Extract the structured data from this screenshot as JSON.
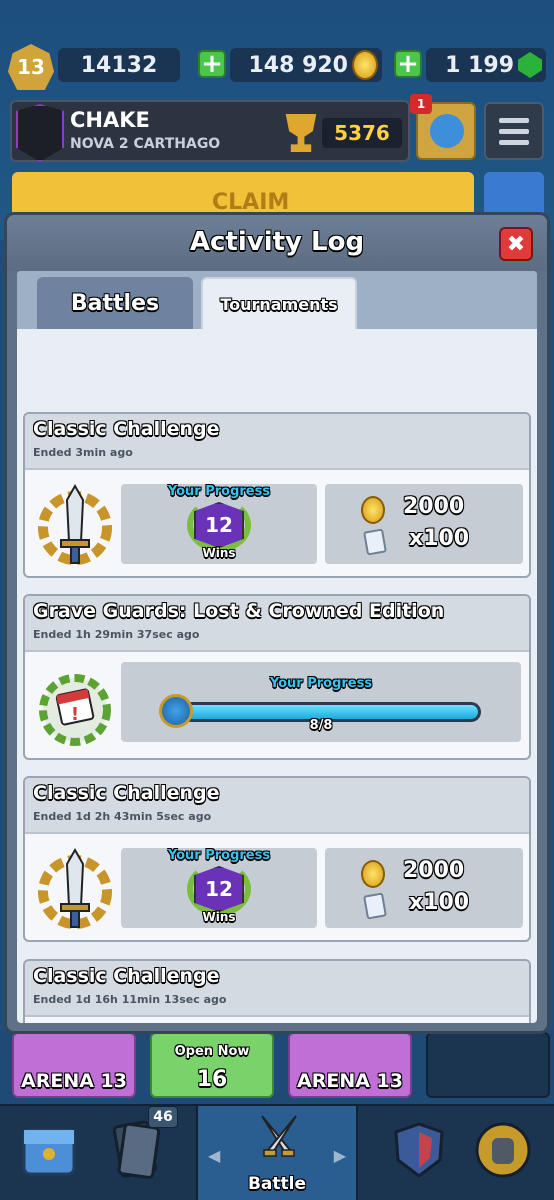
{
  "header": {
    "level": "13",
    "xp": "14132",
    "gold": "148 920",
    "gems": "1 199"
  },
  "profile": {
    "player_name": "CHAKE",
    "clan_name": "NOVA 2 CARTHAGO",
    "trophies": "5376",
    "notification_count": "1"
  },
  "banner": {
    "claim_label": "CLAIM"
  },
  "modal": {
    "title": "Activity Log",
    "close_label": "✖",
    "tabs": [
      {
        "label": "Battles"
      },
      {
        "label": "Tournaments"
      }
    ]
  },
  "tournaments": [
    {
      "title": "Classic Challenge",
      "ended": "Ended 3min ago",
      "progress_label": "Your Progress",
      "wins": "12",
      "wins_label": "Wins",
      "reward_gold": "2000",
      "reward_cards": "x100"
    },
    {
      "title": "Grave Guards: Lost & Crowned Edition",
      "ended": "Ended 1h 29min  37sec ago",
      "progress_label": "Your Progress",
      "progress_text": "8/8",
      "progress_fraction": 1.0
    },
    {
      "title": "Classic Challenge",
      "ended": "Ended 1d 2h 43min  5sec ago",
      "progress_label": "Your Progress",
      "wins": "12",
      "wins_label": "Wins",
      "reward_gold": "2000",
      "reward_cards": "x100"
    },
    {
      "title": "Classic Challenge",
      "ended": "Ended 1d 16h 11min  13sec ago"
    }
  ],
  "chests": [
    {
      "label": "ARENA 13"
    },
    {
      "label": "16",
      "sub_label": "Open Now"
    },
    {
      "label": "ARENA 13"
    }
  ],
  "nav": {
    "cards_badge": "46",
    "battle_label": "Battle"
  },
  "colors": {
    "progress_cyan": "#3bc3f0",
    "close_red": "#e03a3a",
    "wins_purple": "#6a32b7",
    "gold_yellow": "#f2c13a"
  }
}
